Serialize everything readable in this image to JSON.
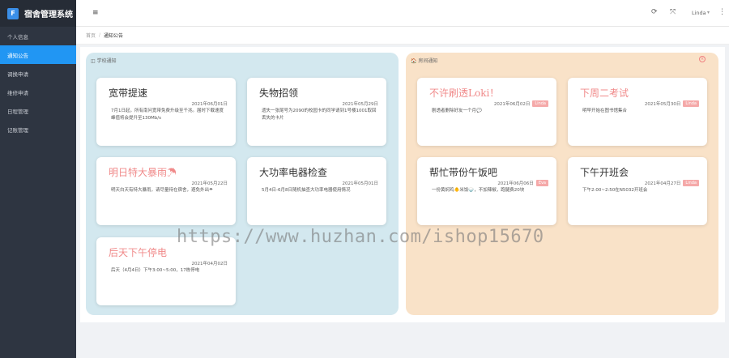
{
  "app": {
    "title": "宿舍管理系统",
    "logo_glyph": "F"
  },
  "sidebar": {
    "items": [
      {
        "label": "个人信息",
        "active": false
      },
      {
        "label": "通知公告",
        "active": true
      },
      {
        "label": "调换申请",
        "active": false
      },
      {
        "label": "维修申请",
        "active": false
      },
      {
        "label": "日程管理",
        "active": false
      },
      {
        "label": "记账管理",
        "active": false
      }
    ]
  },
  "header": {
    "hamburger": "≡",
    "refresh": "⟳",
    "fullscreen": "⤧",
    "user": "Linda",
    "caret": "▾",
    "more": "⋮"
  },
  "breadcrumb": {
    "home": "首页",
    "sep": "/",
    "current": "通知公告"
  },
  "panels": {
    "left": {
      "title": "◫ 学校通知",
      "cards": [
        {
          "title": "宽带提速",
          "date": "2021年06月01日",
          "body": "7月1日起，所有南问宽带免费升级至千兆。届时下载速度峰值将会提升至130Mb/s"
        },
        {
          "title": "失物招领",
          "date": "2021年05月29日",
          "body": "遗失一张尾号为2090的校园卡的同学请到1号楼1001取回丢失的卡片"
        },
        {
          "title": "明日特大暴雨☂",
          "date": "2021年05月22日",
          "body": "明天白天有特大暴雨，请尽量待在宿舍，避免外出☂"
        },
        {
          "title": "大功率电器检查",
          "date": "2021年05月01日",
          "body": "5月4日-6月8日随机抽查大功率电器使用情况"
        },
        {
          "title": "后天下午停电",
          "date": "2021年04月02日",
          "body": "后天（4月4日）下午3:00~5:00，17栋停电"
        }
      ]
    },
    "right": {
      "title": "🏠 房间通知",
      "close": "×",
      "cards": [
        {
          "title": "不许刷透Loki！",
          "date": "2021年06月02日",
          "badge": "Linda",
          "body": "剧透者删除好友一个月💬"
        },
        {
          "title": "下周二考试",
          "date": "2021年05月30日",
          "badge": "Linda",
          "body": "明早开始在图书馆集合"
        },
        {
          "title": "帮忙带份午饭吧",
          "date": "2021年06月06日",
          "badge": "Eva",
          "body": "一份黄焖鸡🐥米饭🍚，不加辣椒，跑腿费20块"
        },
        {
          "title": "下午开班会",
          "date": "2021年04月27日",
          "badge": "Linda",
          "body": "下午2:00~2:50在N5032开班会"
        }
      ]
    }
  },
  "watermark": "https://www.huzhan.com/ishop15670",
  "colors": {
    "sidebar_bg": "#2e3541",
    "active_item": "#2196f3",
    "left_panel": "#d3e8ef",
    "right_panel": "#f9e2c8",
    "title_red": "#f08a8a",
    "badge": "#f5a9a9"
  }
}
